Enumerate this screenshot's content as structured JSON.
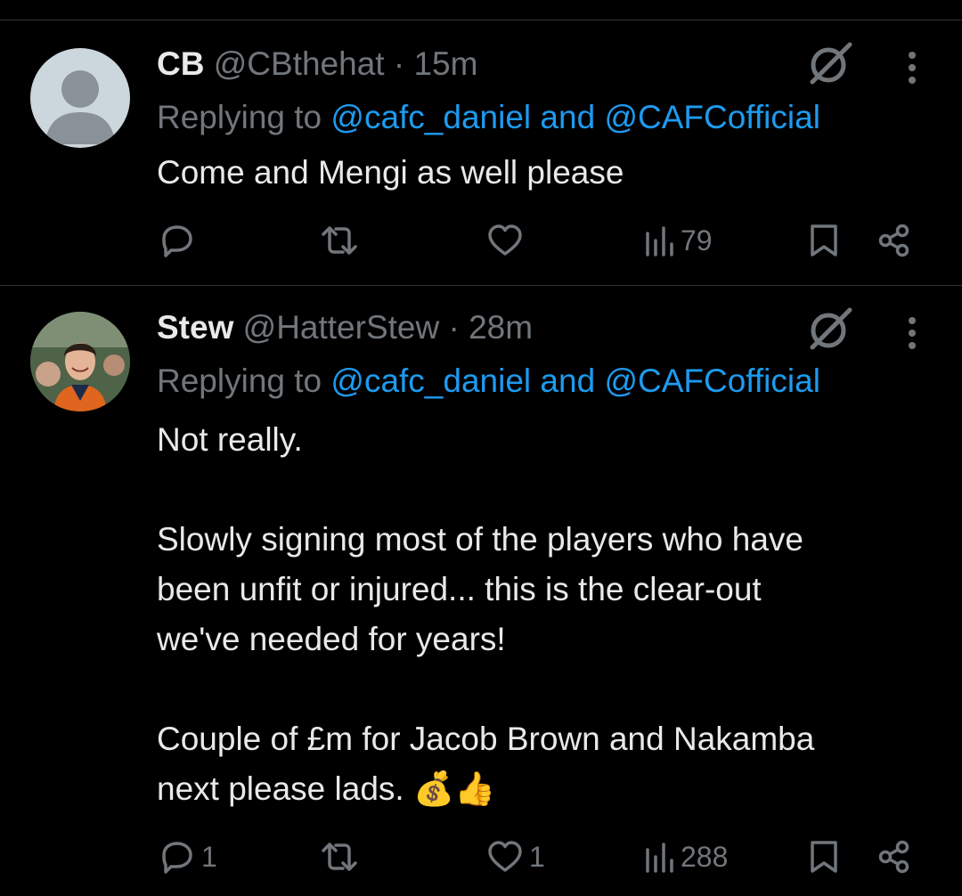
{
  "tweets": [
    {
      "name": "CB",
      "handle": "@CBthehat",
      "separator": "·",
      "time": "15m",
      "replying_prefix": "Replying to",
      "mention1": "@cafc_daniel",
      "conjunction": "and",
      "mention2": "@CAFCofficial",
      "text": [
        "Come and Mengi as well please"
      ],
      "replies": "",
      "retweets": "",
      "likes": "",
      "views": "79"
    },
    {
      "name": "Stew",
      "handle": "@HatterStew",
      "separator": "·",
      "time": "28m",
      "replying_prefix": "Replying to",
      "mention1": "@cafc_daniel",
      "conjunction": "and",
      "mention2": "@CAFCofficial",
      "text": [
        "Not really.",
        "Slowly signing most of the players who have",
        "been unfit or injured... this is the clear-out",
        "we've needed for years!",
        "Couple of £m for Jacob Brown and Nakamba",
        "next please lads. 💰👍"
      ],
      "replies": "1",
      "retweets": "",
      "likes": "1",
      "views": "288"
    }
  ],
  "icons": {
    "reply": "reply-icon",
    "retweet": "retweet-icon",
    "like": "heart-icon",
    "views": "views-icon",
    "bookmark": "bookmark-icon",
    "share": "share-icon",
    "grok": "grok-icon",
    "more": "more-icon"
  },
  "colors": {
    "background": "#000000",
    "text": "#e7e9ea",
    "muted": "#71767b",
    "link": "#1d9bf0",
    "divider": "#2f3336"
  }
}
